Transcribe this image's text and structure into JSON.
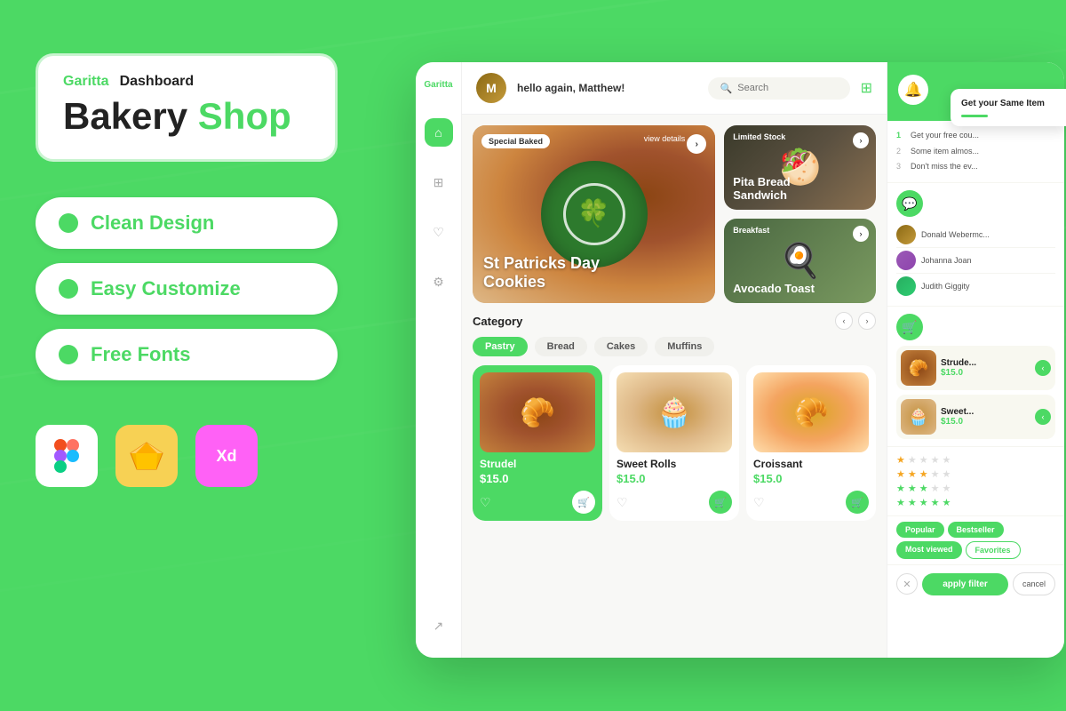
{
  "brand": {
    "name": "Garitta",
    "label": "Dashboard",
    "title_black": "Bakery",
    "title_green": " Shop"
  },
  "features": [
    {
      "id": "clean-design",
      "label": "Clean Design"
    },
    {
      "id": "easy-customize",
      "label": "Easy Customize"
    },
    {
      "id": "free-fonts",
      "label": "Free Fonts"
    }
  ],
  "tools": [
    {
      "id": "figma",
      "icon": "✦",
      "label": "Figma"
    },
    {
      "id": "sketch",
      "icon": "◆",
      "label": "Sketch"
    },
    {
      "id": "xd",
      "icon": "Xd",
      "label": "Adobe XD"
    }
  ],
  "sidebar": {
    "logo": "Garitta",
    "items": [
      {
        "id": "home",
        "icon": "⌂",
        "active": true
      },
      {
        "id": "grid",
        "icon": "⊞",
        "active": false
      },
      {
        "id": "heart",
        "icon": "♡",
        "active": false
      },
      {
        "id": "settings",
        "icon": "⚙",
        "active": false
      },
      {
        "id": "logout",
        "icon": "⎋",
        "active": false
      }
    ]
  },
  "topbar": {
    "greeting": "hello again, ",
    "user": "Matthew!",
    "search_placeholder": "Search"
  },
  "banners": {
    "main": {
      "tag": "Special Baked",
      "title_line1": "St Patricks Day",
      "title_line2": "Cookies",
      "view_details": "view details"
    },
    "pita": {
      "tag": "Limited Stock",
      "title_line1": "Pita Bread",
      "title_line2": "Sandwich"
    },
    "avocado": {
      "tag": "Breakfast",
      "title": "Avocado Toast"
    }
  },
  "categories": {
    "title": "Category",
    "items": [
      "Pastry",
      "Bread",
      "Cakes",
      "Muffins"
    ],
    "active": "Pastry"
  },
  "products": [
    {
      "id": "strudel",
      "name": "Strudel",
      "price": "$15.0"
    },
    {
      "id": "sweet-rolls",
      "name": "Sweet Rolls",
      "price": "$15.0"
    },
    {
      "id": "croissant",
      "name": "Croissant",
      "price": "$15.0"
    }
  ],
  "notifications": {
    "items": [
      {
        "num": "1",
        "text": "Get your free cou..."
      },
      {
        "num": "2",
        "text": "Some item almos..."
      },
      {
        "num": "3",
        "text": "Don't miss the ev..."
      }
    ]
  },
  "chat_users": [
    {
      "name": "Donald Webermc..."
    },
    {
      "name": "Johanna Joan"
    },
    {
      "name": "Judith Giggity"
    }
  ],
  "cart": {
    "items": [
      {
        "id": "strudel-cart",
        "name": "Strude...",
        "price": "$15.0"
      },
      {
        "id": "sweet-rolls-cart",
        "name": "Sweet...",
        "price": "$15.0"
      }
    ]
  },
  "ratings": {
    "rows": [
      {
        "filled": 1,
        "empty": 4
      },
      {
        "filled": 3,
        "empty": 2
      }
    ],
    "green_rows": [
      {
        "filled": 3,
        "empty": 2
      },
      {
        "filled": 5,
        "empty": 0
      }
    ]
  },
  "filter_tags": [
    {
      "label": "Popular",
      "active": true
    },
    {
      "label": "Bestseller",
      "active": true
    },
    {
      "label": "Most viewed",
      "active": true
    },
    {
      "label": "Favorites",
      "active": false
    }
  ],
  "filter_buttons": {
    "apply": "apply filter",
    "cancel": "cancel"
  },
  "colors": {
    "green": "#4CD964",
    "dark": "#222222",
    "light_bg": "#f8f8f6"
  }
}
